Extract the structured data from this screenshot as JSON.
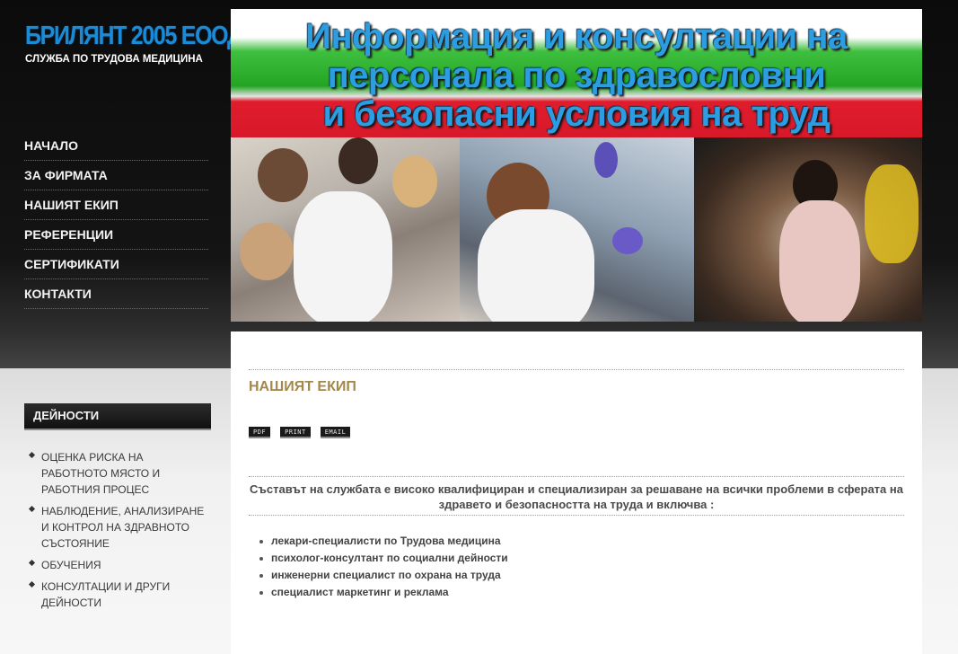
{
  "logo": {
    "title": "БРИЛЯНТ 2005 ЕООД",
    "subtitle": "СЛУЖБА ПО ТРУДОВА МЕДИЦИНА"
  },
  "nav": [
    {
      "label": "НАЧАЛО"
    },
    {
      "label": "ЗА ФИРМАТА"
    },
    {
      "label": "НАШИЯТ ЕКИП"
    },
    {
      "label": "РЕФЕРЕНЦИИ"
    },
    {
      "label": "СЕРТИФИКАТИ"
    },
    {
      "label": "КОНТАКТИ"
    }
  ],
  "banner": {
    "line1": "Информация и консултации на",
    "line2": "персонала по здравословни",
    "line3": "и безопасни условия на труд"
  },
  "sidebar": {
    "heading": "ДЕЙНОСТИ",
    "items": [
      {
        "label": "ОЦЕНКА РИСКА НА РАБОТНОТО МЯСТО И РАБОТНИЯ ПРОЦЕС"
      },
      {
        "label": "НАБЛЮДЕНИЕ, АНАЛИЗИРАНЕ И КОНТРОЛ НА ЗДРАВНОТО СЪСТОЯНИЕ"
      },
      {
        "label": "ОБУЧЕНИЯ"
      },
      {
        "label": "КОНСУЛТАЦИИ И ДРУГИ ДЕЙНОСТИ"
      }
    ]
  },
  "main": {
    "title": "НАШИЯТ ЕКИП",
    "icons": {
      "pdf": "PDF",
      "print": "PRINT",
      "email": "EMAIL"
    },
    "intro": "Съставът на службата е високо квалифициран и специализиран за решаване на всички проблеми в сферата на здравето и безопасността на труда и включва :",
    "list": [
      "лекари-специалисти по Трудова медицина",
      "психолог-консултант по социални дейности",
      "инженерни специалист по охрана на труда",
      "специалист маркетинг и реклама"
    ]
  },
  "colors": {
    "accent_title": "#a3884c",
    "logo_blue": "#1c8bd6",
    "banner_text": "#2c9de0"
  }
}
